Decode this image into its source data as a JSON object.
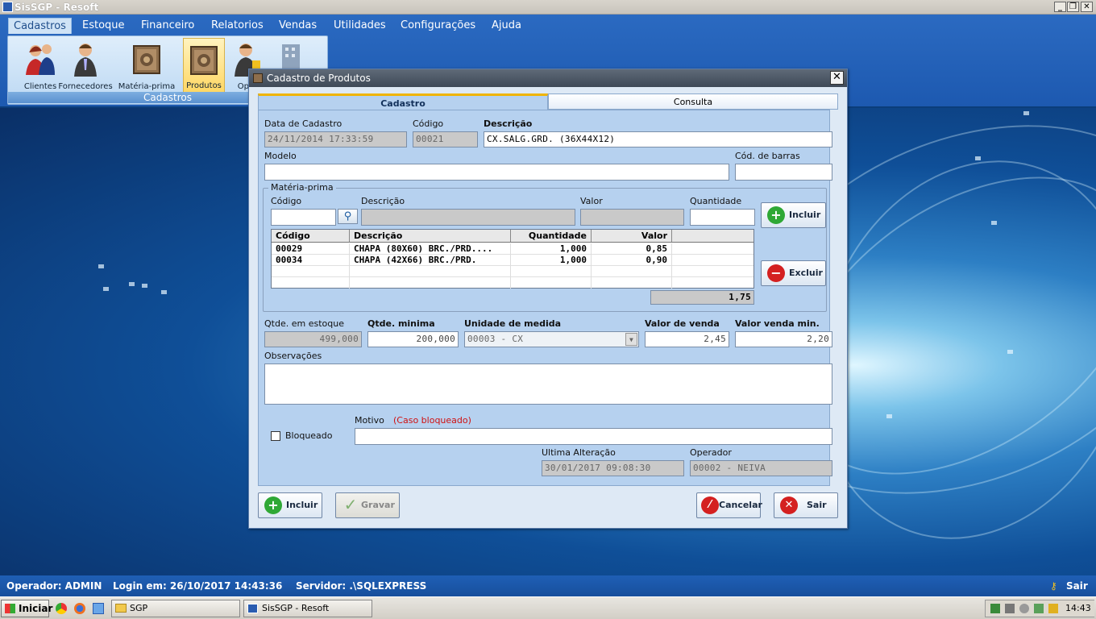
{
  "window": {
    "title": "SisSGP - Resoft",
    "min": "_",
    "restore": "❐",
    "close": "✕"
  },
  "menu": [
    "Cadastros",
    "Estoque",
    "Financeiro",
    "Relatorios",
    "Vendas",
    "Utilidades",
    "Configurações",
    "Ajuda"
  ],
  "ribbon": {
    "group": "Cadastros",
    "items": [
      "Clientes",
      "Fornecedores",
      "Matéria-prima",
      "Produtos",
      "Oper",
      ""
    ]
  },
  "dialog": {
    "title": "Cadastro de Produtos",
    "close": "✕",
    "tabs": [
      "Cadastro",
      "Consulta"
    ],
    "fields": {
      "data_cadastro_label": "Data de Cadastro",
      "data_cadastro": "24/11/2014 17:33:59",
      "codigo_label": "Código",
      "codigo": "00021",
      "descricao_label": "Descrição",
      "descricao": "CX.SALG.GRD. (36X44X12)",
      "modelo_label": "Modelo",
      "modelo": "",
      "barras_label": "Cód. de barras",
      "barras": ""
    },
    "materia": {
      "group_label": "Matéria-prima",
      "codigo_label": "Código",
      "descricao_label": "Descrição",
      "valor_label": "Valor",
      "quantidade_label": "Quantidade",
      "incluir": "Incluir",
      "excluir": "Excluir",
      "columns": [
        "Código",
        "Descrição",
        "Quantidade",
        "Valor"
      ],
      "rows": [
        [
          "00029",
          "CHAPA (80X60) BRC./PRD....",
          "1,000",
          "0,85"
        ],
        [
          "00034",
          "CHAPA (42X66) BRC./PRD.",
          "1,000",
          "0,90"
        ]
      ],
      "total": "1,75"
    },
    "stock": {
      "qtde_estoque_label": "Qtde. em estoque",
      "qtde_estoque": "499,000",
      "qtde_minima_label": "Qtde. minima",
      "qtde_minima": "200,000",
      "unidade_label": "Unidade de medida",
      "unidade": "00003 - CX",
      "valor_venda_label": "Valor de venda",
      "valor_venda": "2,45",
      "valor_min_label": "Valor venda min.",
      "valor_min": "2,20"
    },
    "observacoes_label": "Observações",
    "observacoes": "",
    "bloqueado_label": "Bloqueado",
    "motivo_label": "Motivo",
    "motivo_hint": "(Caso bloqueado)",
    "motivo": "",
    "ultima_alteracao_label": "Ultima Alteração",
    "ultima_alteracao": "30/01/2017 09:08:30",
    "operador_label": "Operador",
    "operador": "00002 - NEIVA",
    "buttons": {
      "incluir": "Incluir",
      "gravar": "Gravar",
      "cancelar": "Cancelar",
      "sair": "Sair"
    }
  },
  "status": {
    "operador": "Operador: ADMIN",
    "login": "Login em: 26/10/2017 14:43:36",
    "servidor": "Servidor: .\\SQLEXPRESS",
    "sair": "Sair"
  },
  "taskbar": {
    "start": "Iniciar",
    "tasks": [
      "SGP",
      "SisSGP - Resoft"
    ],
    "clock": "14:43"
  },
  "colors": {
    "menu_bg": "#1d59b0",
    "dialog_bg": "#dee9f5",
    "panel_bg": "#b6d1ef",
    "status_bg": "#174f9c"
  }
}
